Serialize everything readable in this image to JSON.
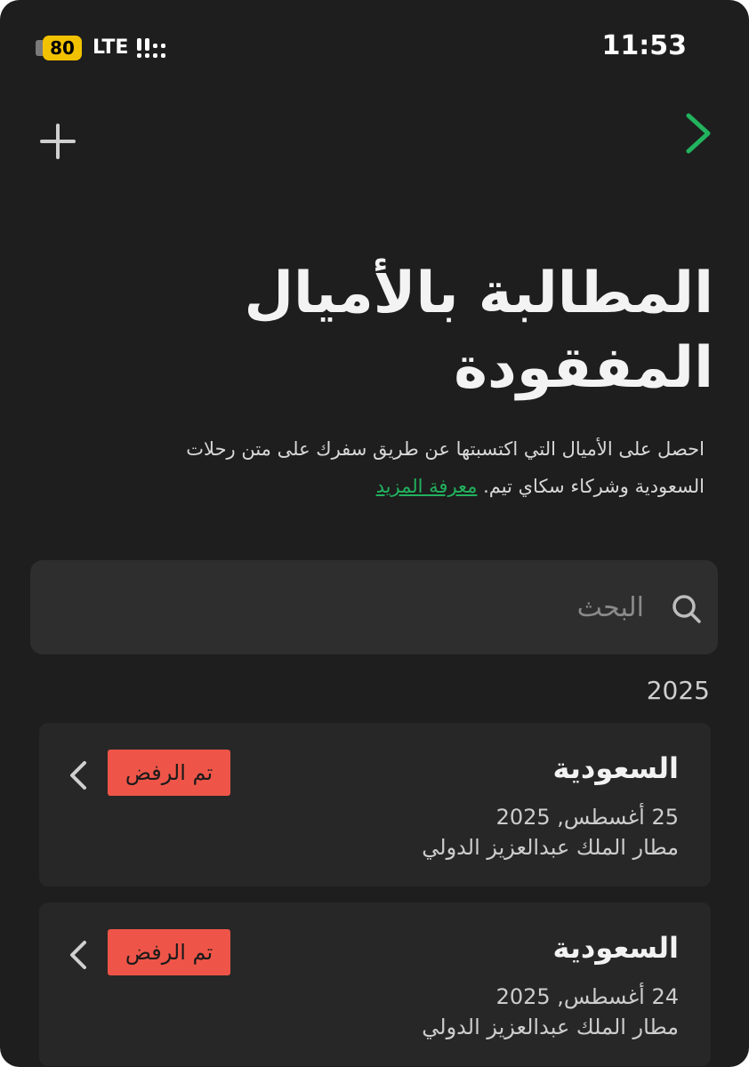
{
  "status_bar": {
    "battery": "80",
    "network": "LTE",
    "time": "11:53"
  },
  "nav": {
    "add_icon": "plus-icon",
    "forward_icon": "chevron-right-icon",
    "accent": "#22b35e"
  },
  "page": {
    "title": "المطالبة بالأميال المفقودة",
    "description": "احصل على الأميال التي اكتسبتها عن طريق سفرك على متن رحلات السعودية وشركاء سكاي تيم.",
    "learn_more": "معرفة المزيد"
  },
  "search": {
    "placeholder": "البحث",
    "value": ""
  },
  "section_year": "2025",
  "claims": [
    {
      "airline": "السعودية",
      "date": "25 أغسطس, 2025",
      "airport": "مطار الملك عبدالعزيز الدولي",
      "status": "تم الرفض",
      "status_color": "#ee5548"
    },
    {
      "airline": "السعودية",
      "date": "24 أغسطس, 2025",
      "airport": "مطار الملك عبدالعزيز الدولي",
      "status": "تم الرفض",
      "status_color": "#ee5548"
    }
  ]
}
